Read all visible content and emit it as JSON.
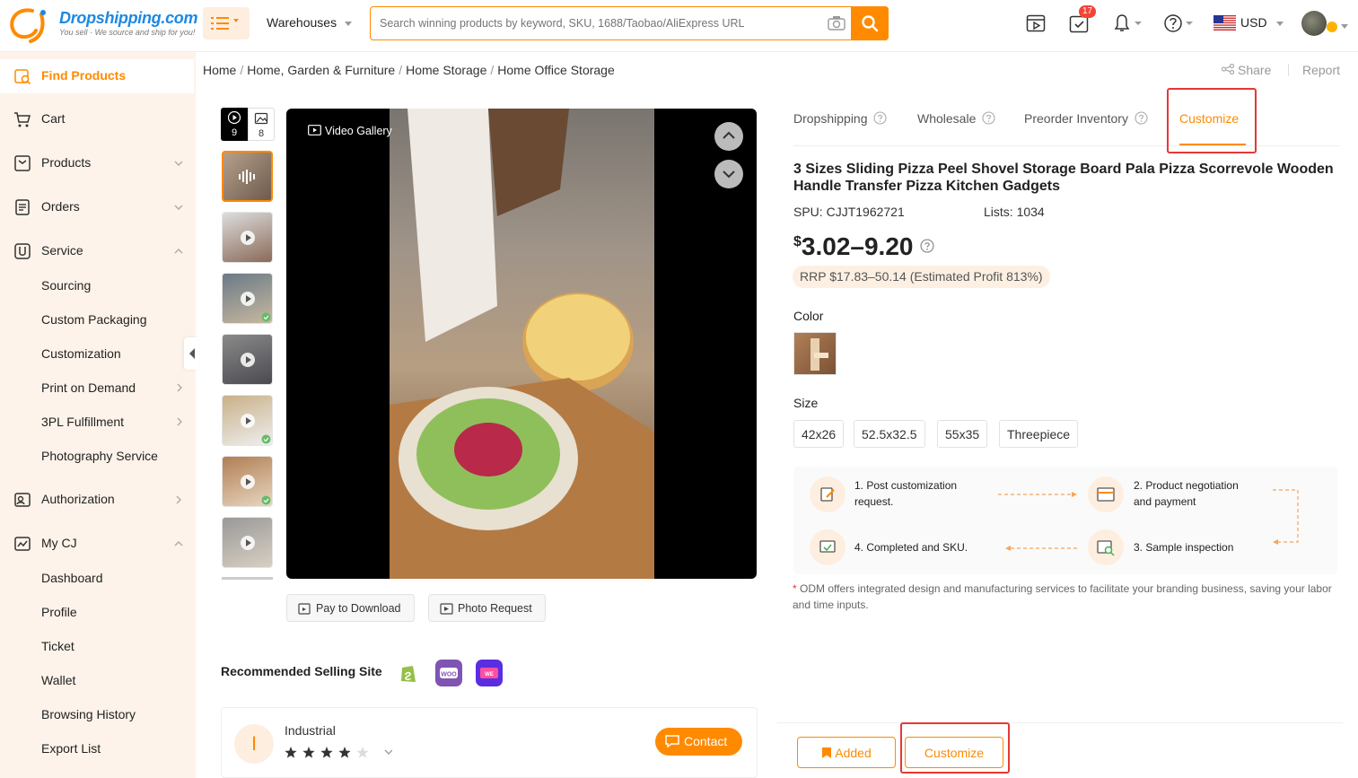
{
  "header": {
    "logo_text": "Dropshipping.com",
    "logo_tagline": "You sell · We source and ship for you!",
    "warehouses_label": "Warehouses",
    "search_placeholder": "Search winning products by keyword, SKU, 1688/Taobao/AliExpress URL",
    "cart_count": "17",
    "currency": "USD"
  },
  "sidebar": {
    "find_products": "Find Products",
    "cart": "Cart",
    "products": "Products",
    "orders": "Orders",
    "service": "Service",
    "service_items": [
      "Sourcing",
      "Custom Packaging",
      "Customization",
      "Print on Demand",
      "3PL Fulfillment",
      "Photography Service"
    ],
    "authorization": "Authorization",
    "my_cj": "My CJ",
    "my_cj_items": [
      "Dashboard",
      "Profile",
      "Ticket",
      "Wallet",
      "Browsing History",
      "Export List"
    ]
  },
  "breadcrumb": [
    "Home",
    "Home, Garden & Furniture",
    "Home Storage",
    "Home Office Storage"
  ],
  "actions": {
    "share": "Share",
    "report": "Report"
  },
  "gallery": {
    "video_count": "9",
    "image_count": "8",
    "video_gallery_label": "Video Gallery",
    "pay_to_download": "Pay to Download",
    "photo_request": "Photo Request"
  },
  "tabs": [
    "Dropshipping",
    "Wholesale",
    "Preorder Inventory",
    "Customize"
  ],
  "product": {
    "title": "3 Sizes Sliding Pizza Peel Shovel Storage Board Pala Pizza Scorrevole Wooden Handle Transfer Pizza Kitchen Gadgets",
    "spu_label": "SPU:",
    "spu": "CJJT1962721",
    "lists_label": "Lists:",
    "lists": "1034",
    "currency_symbol": "$",
    "price": "3.02–9.20",
    "rrp": "RRP $17.83–50.14 (Estimated Profit 813%)",
    "color_label": "Color",
    "size_label": "Size",
    "sizes": [
      "42x26",
      "52.5x32.5",
      "55x35",
      "Threepiece"
    ]
  },
  "steps": [
    "1. Post customization request.",
    "2. Product negotiation and payment",
    "3. Sample inspection",
    "4. Completed and SKU."
  ],
  "odm_note_star": "*",
  "odm_note": "ODM offers integrated design and manufacturing services to facilitate your branding business, saving your labor and time inputs.",
  "recommended": {
    "label": "Recommended Selling Site"
  },
  "store": {
    "initial": "I",
    "name": "Industrial",
    "rating": 4,
    "contact": "Contact"
  },
  "bottom": {
    "added": "Added",
    "customize": "Customize"
  },
  "colors": {
    "accent": "#ff8a00",
    "highlight": "#e53935",
    "brand_blue": "#1e88e5"
  }
}
